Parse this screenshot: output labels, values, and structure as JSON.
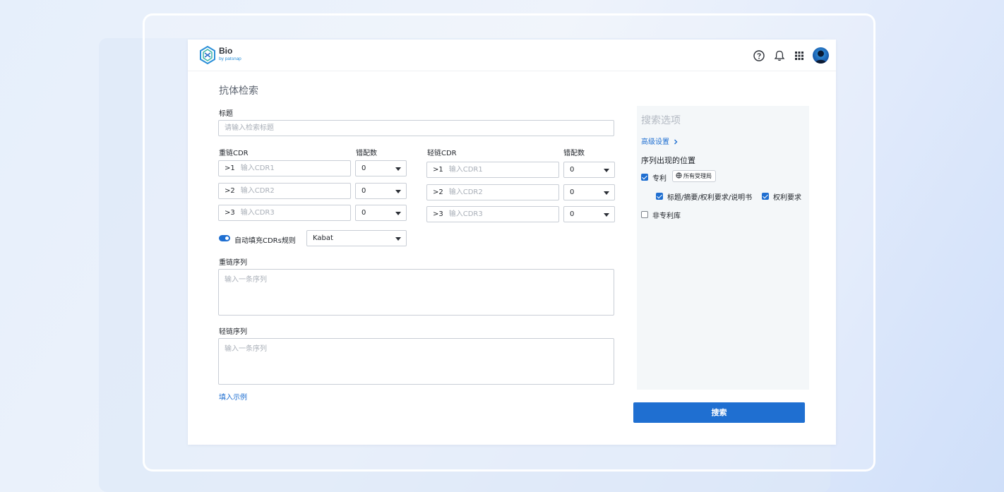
{
  "app": {
    "logo_title": "Bio",
    "logo_subtitle": "by patsnap",
    "brand_color": "#1f6fd1",
    "icons": [
      "help-icon",
      "bell-icon",
      "apps-grid-icon",
      "avatar"
    ]
  },
  "page": {
    "title": "抗体检索"
  },
  "title_field": {
    "label": "标题",
    "placeholder": "请输入检索标题"
  },
  "heavy_cdr": {
    "label": "重链CDR",
    "mismatch_label": "错配数",
    "rows": [
      {
        "prefix": ">1",
        "placeholder": "输入CDR1",
        "mismatch": "0"
      },
      {
        "prefix": ">2",
        "placeholder": "输入CDR2",
        "mismatch": "0"
      },
      {
        "prefix": ">3",
        "placeholder": "输入CDR3",
        "mismatch": "0"
      }
    ]
  },
  "light_cdr": {
    "label": "轻链CDR",
    "mismatch_label": "错配数",
    "rows": [
      {
        "prefix": ">1",
        "placeholder": "输入CDR1",
        "mismatch": "0"
      },
      {
        "prefix": ">2",
        "placeholder": "输入CDR2",
        "mismatch": "0"
      },
      {
        "prefix": ">3",
        "placeholder": "输入CDR3",
        "mismatch": "0"
      }
    ]
  },
  "auto_fill": {
    "label": "自动填充CDRs规则",
    "enabled": true,
    "rule": "Kabat"
  },
  "heavy_seq": {
    "label": "重链序列",
    "placeholder": "输入一条序列"
  },
  "light_seq": {
    "label": "轻链序列",
    "placeholder": "输入一条序列"
  },
  "fill_example": "填入示例",
  "search_options": {
    "title": "搜索选项",
    "advanced": "高级设置",
    "position_title": "序列出现的位置",
    "patent": {
      "label": "专利",
      "checked": true,
      "authority_chip": "所有受理局"
    },
    "patent_sub": [
      {
        "label": "标题/摘要/权利要求/说明书",
        "checked": true
      },
      {
        "label": "权利要求",
        "checked": true
      }
    ],
    "non_patent": {
      "label": "非专利库",
      "checked": false
    }
  },
  "search_button": "搜索"
}
